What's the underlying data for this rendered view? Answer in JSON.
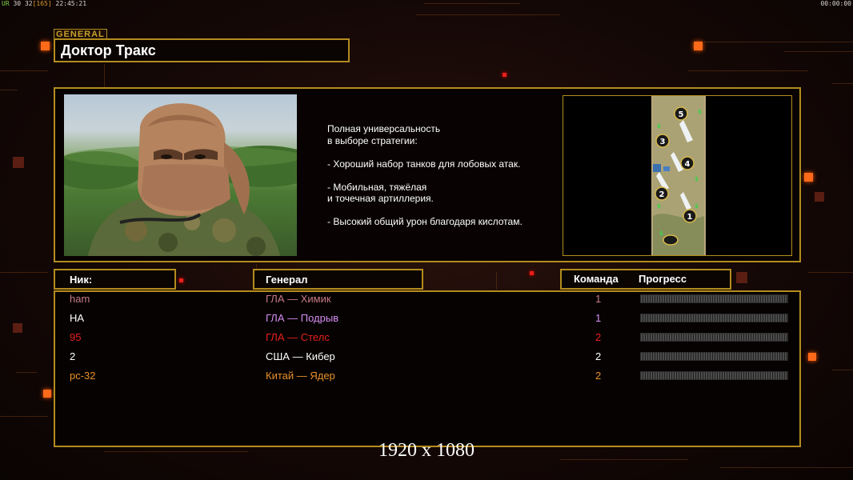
{
  "hud": {
    "left_a": "UR",
    "left_b": "30",
    "left_c": "32",
    "left_d": "[165]",
    "left_time": "22:45:21",
    "right_time": "00:00:00"
  },
  "general_tag": "GENERAL",
  "title": "Доктор Тракс",
  "description": "Полная универсальность\nв выборе стратегии:\n\n- Хороший набор танков для лобовых атак.\n\n- Мобильная, тяжёлая\nи точечная артиллерия.\n\n- Высокий общий урон благодаря кислотам.",
  "headers": {
    "nick": "Ник:",
    "general": "Генерал",
    "team": "Команда",
    "progress": "Прогресс"
  },
  "players": [
    {
      "nick": "ham",
      "general": "ГЛА — Химик",
      "team": "1",
      "progress": 0,
      "color": "#c77a86"
    },
    {
      "nick": "HA",
      "general": "ГЛА — Подрыв",
      "team": "1",
      "progress": 0,
      "color": "#d48cf0",
      "nick_color": "#ffffff"
    },
    {
      "nick": "95",
      "general": "ГЛА — Стелс",
      "team": "2",
      "progress": 0,
      "color": "#e8201c"
    },
    {
      "nick": "2",
      "general": "США — Кибер",
      "team": "2",
      "progress": 0,
      "color": "#ffffff"
    },
    {
      "nick": "pc-32",
      "general": "Китай — Ядер",
      "team": "2",
      "progress": 0,
      "color": "#e8902a"
    }
  ],
  "map_markers": [
    "5",
    "3",
    "4",
    "2",
    "1"
  ],
  "resolution_label": "1920 x 1080",
  "colors": {
    "frame": "#b38c1e",
    "accent": "#ff6a1a"
  }
}
